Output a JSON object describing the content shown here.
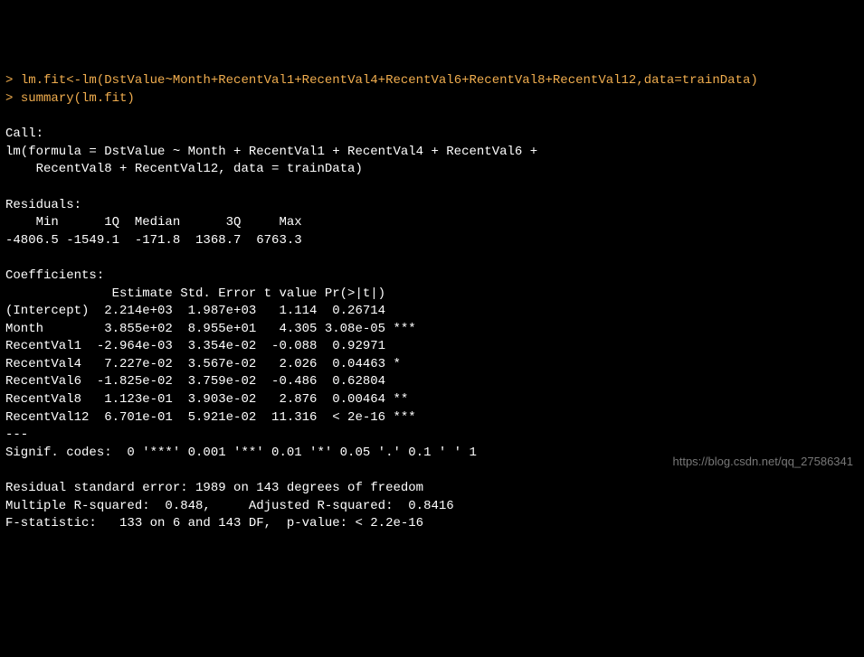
{
  "console": {
    "prompt": "> ",
    "command1": "lm.fit<-lm(DstValue~Month+RecentVal1+RecentVal4+RecentVal6+RecentVal8+RecentVal12,data=trainData)",
    "command2": "summary(lm.fit)",
    "output": {
      "blank1": "",
      "call_header": "Call:",
      "call_line1": "lm(formula = DstValue ~ Month + RecentVal1 + RecentVal4 + RecentVal6 + ",
      "call_line2": "    RecentVal8 + RecentVal12, data = trainData)",
      "blank2": "",
      "residuals_header": "Residuals:",
      "residuals_cols": "    Min      1Q  Median      3Q     Max ",
      "residuals_vals": "-4806.5 -1549.1  -171.8  1368.7  6763.3 ",
      "blank3": "",
      "coef_header": "Coefficients:",
      "coef_cols": "              Estimate Std. Error t value Pr(>|t|)    ",
      "coef_intercept": "(Intercept)  2.214e+03  1.987e+03   1.114  0.26714    ",
      "coef_month": "Month        3.855e+02  8.955e+01   4.305 3.08e-05 ***",
      "coef_rv1": "RecentVal1  -2.964e-03  3.354e-02  -0.088  0.92971    ",
      "coef_rv4": "RecentVal4   7.227e-02  3.567e-02   2.026  0.04463 *  ",
      "coef_rv6": "RecentVal6  -1.825e-02  3.759e-02  -0.486  0.62804    ",
      "coef_rv8": "RecentVal8   1.123e-01  3.903e-02   2.876  0.00464 ** ",
      "coef_rv12": "RecentVal12  6.701e-01  5.921e-02  11.316  < 2e-16 ***",
      "sep": "---",
      "signif": "Signif. codes:  0 '***' 0.001 '**' 0.01 '*' 0.05 '.' 0.1 ' ' 1",
      "blank4": "",
      "rse": "Residual standard error: 1989 on 143 degrees of freedom",
      "rsq": "Multiple R-squared:  0.848,\tAdjusted R-squared:  0.8416 ",
      "fstat": "F-statistic:   133 on 6 and 143 DF,  p-value: < 2.2e-16"
    }
  },
  "watermark": "https://blog.csdn.net/qq_27586341"
}
